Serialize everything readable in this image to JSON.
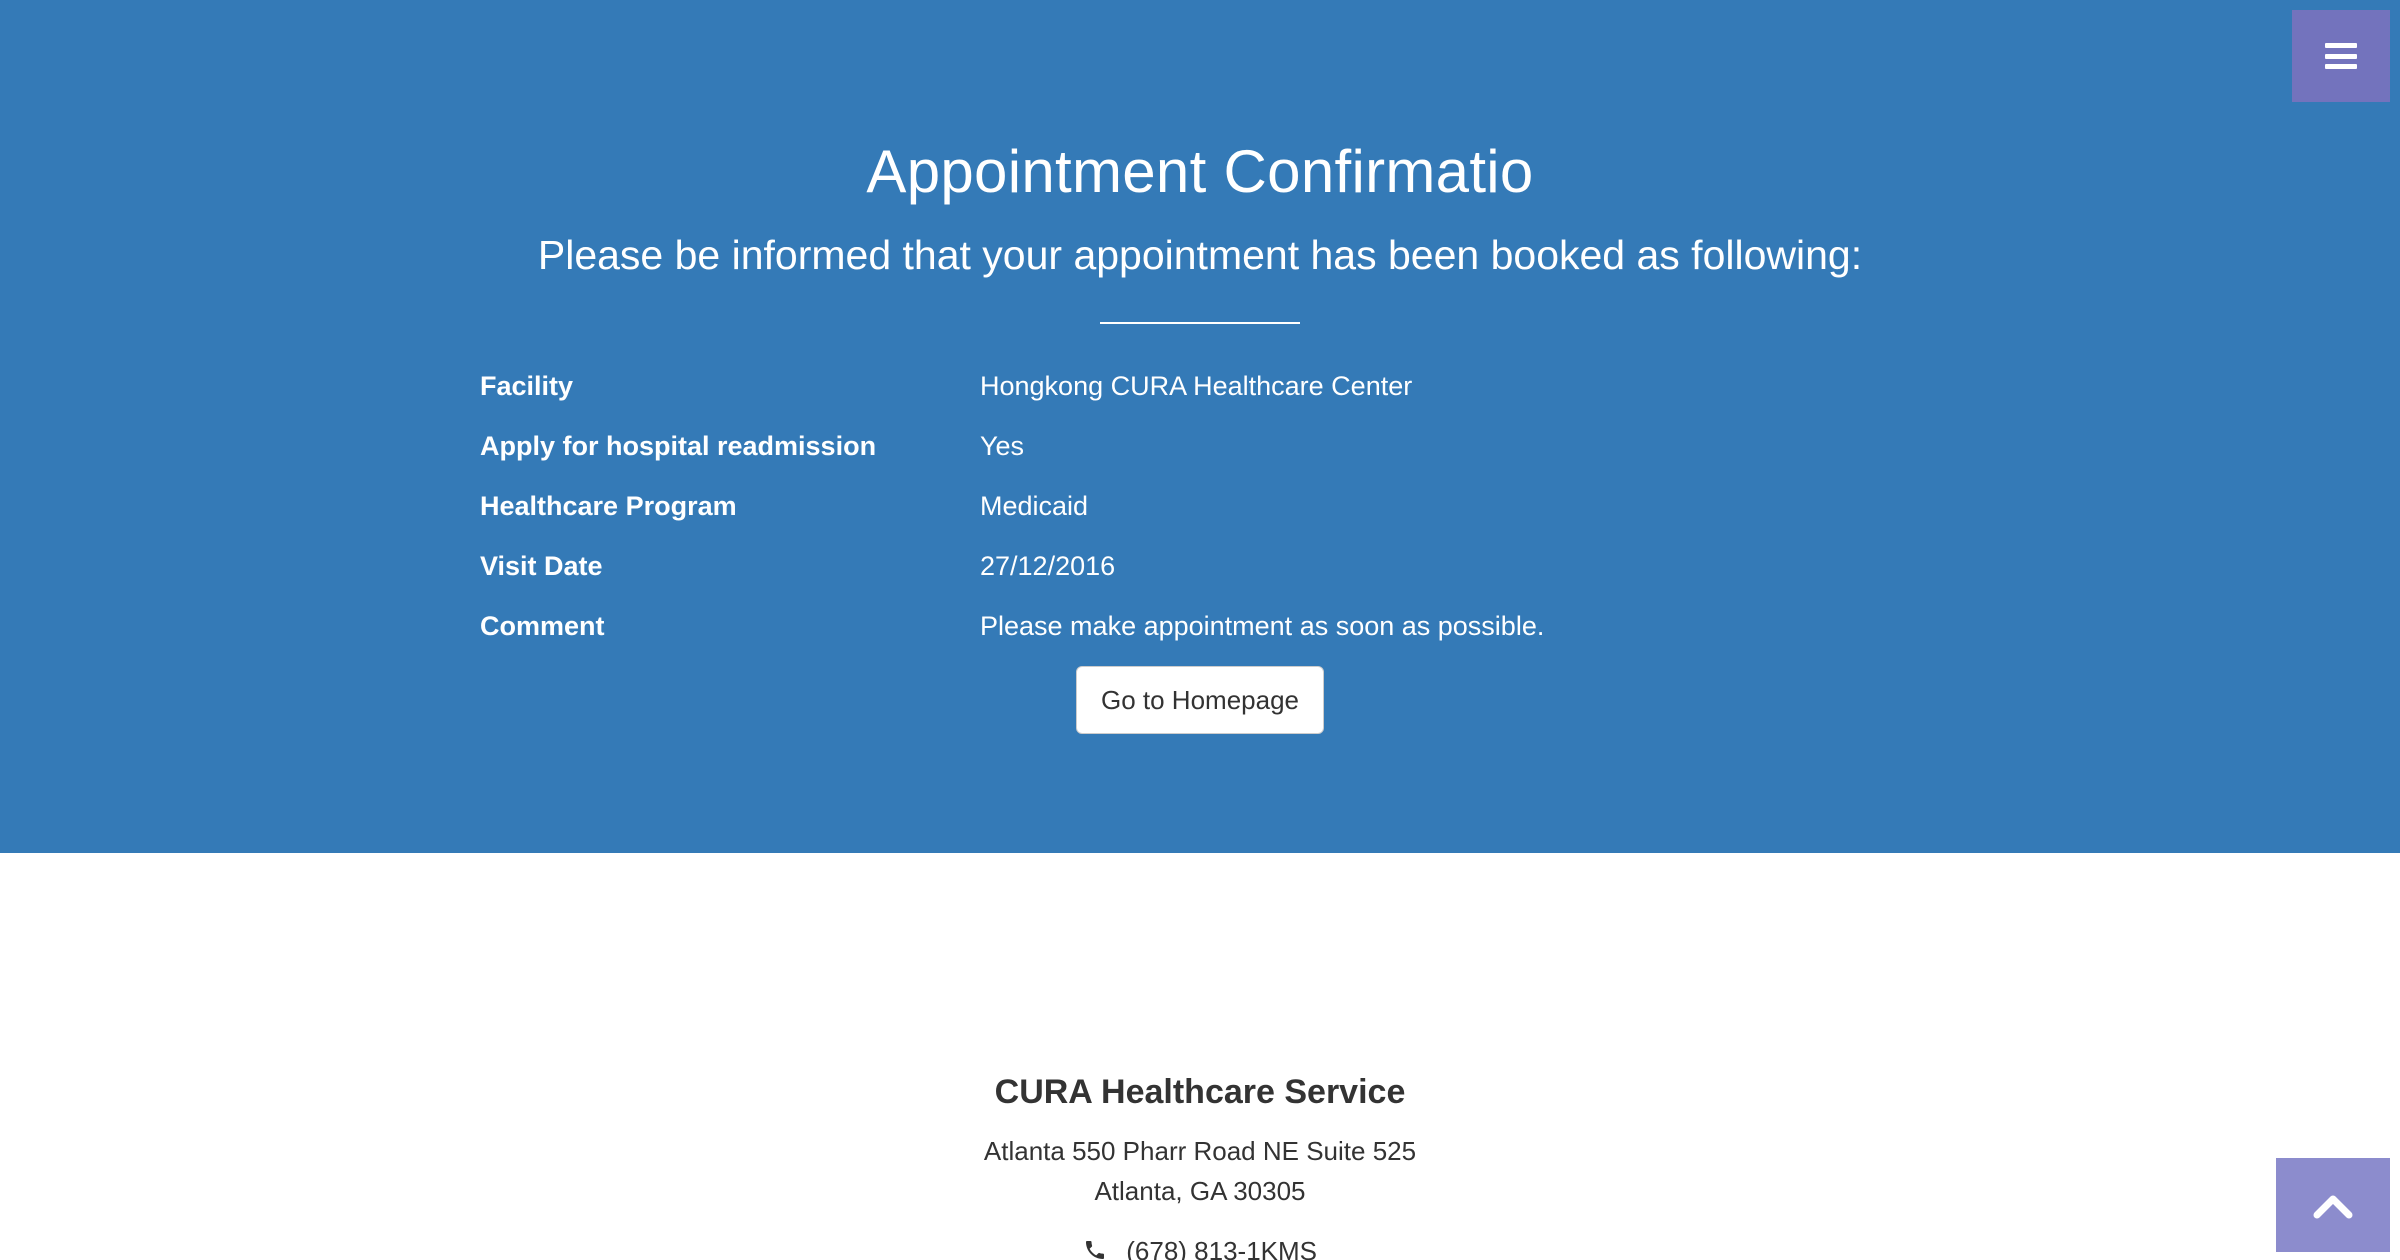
{
  "header": {
    "title": "Appointment Confirmatio",
    "subtitle": "Please be informed that your appointment has been booked as following:",
    "menu_icon": "hamburger-icon"
  },
  "appointment": {
    "rows": [
      {
        "label": "Facility",
        "value": "Hongkong CURA Healthcare Center"
      },
      {
        "label": "Apply for hospital readmission",
        "value": "Yes"
      },
      {
        "label": "Healthcare Program",
        "value": "Medicaid"
      },
      {
        "label": "Visit Date",
        "value": "27/12/2016"
      },
      {
        "label": "Comment",
        "value": "Please make appointment as soon as possible."
      }
    ]
  },
  "actions": {
    "homepage_label": "Go to Homepage"
  },
  "footer": {
    "title": "CURA Healthcare Service",
    "address_line1": "Atlanta 550 Pharr Road NE Suite 525",
    "address_line2": "Atlanta, GA 30305",
    "phone": "(678) 813-1KMS",
    "phone_icon": "phone-icon"
  },
  "scroll_top_icon": "chevron-up-icon",
  "colors": {
    "hero_bg": "#347ab7",
    "menu_bg": "#7373bd",
    "scroll_top_bg": "#8c8ccd"
  }
}
